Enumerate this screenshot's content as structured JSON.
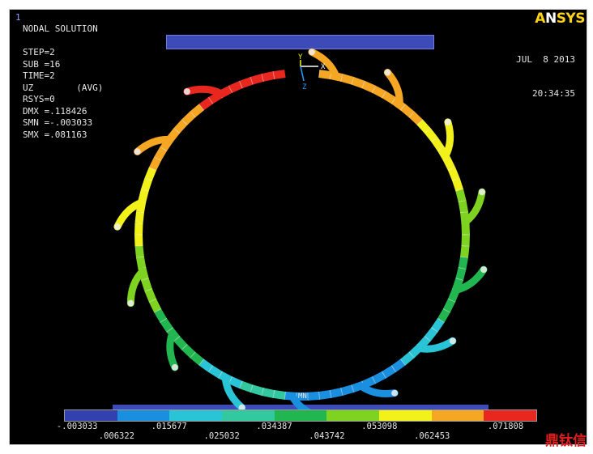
{
  "window": {
    "number": "1"
  },
  "info_lines": [
    "NODAL SOLUTION",
    "",
    "STEP=2",
    "SUB =16",
    "TIME=2",
    "UZ        (AVG)",
    "RSYS=0",
    "DMX =.118426",
    "SMN =-.003033",
    "SMX =.081163"
  ],
  "date": {
    "line1": "JUL  8 2013",
    "line2": "20:34:35"
  },
  "logo": {
    "prefix": "A",
    "mark": "N",
    "suffix": "SYS"
  },
  "triad": {
    "y": "Y",
    "x": "X",
    "z": "Z"
  },
  "min_marker": "MN",
  "legend": {
    "colors": [
      "#3340b0",
      "#1a8fe0",
      "#29c4d6",
      "#33c9a0",
      "#21b64f",
      "#7ed321",
      "#f2f21a",
      "#f5a623",
      "#e8271e"
    ],
    "labels_top": [
      "-.003033",
      ".015677",
      ".034387",
      ".053098",
      ".071808"
    ],
    "labels_bottom": [
      ".006322",
      ".025032",
      ".043742",
      ".062453"
    ]
  },
  "watermark": "鼎钛信"
}
